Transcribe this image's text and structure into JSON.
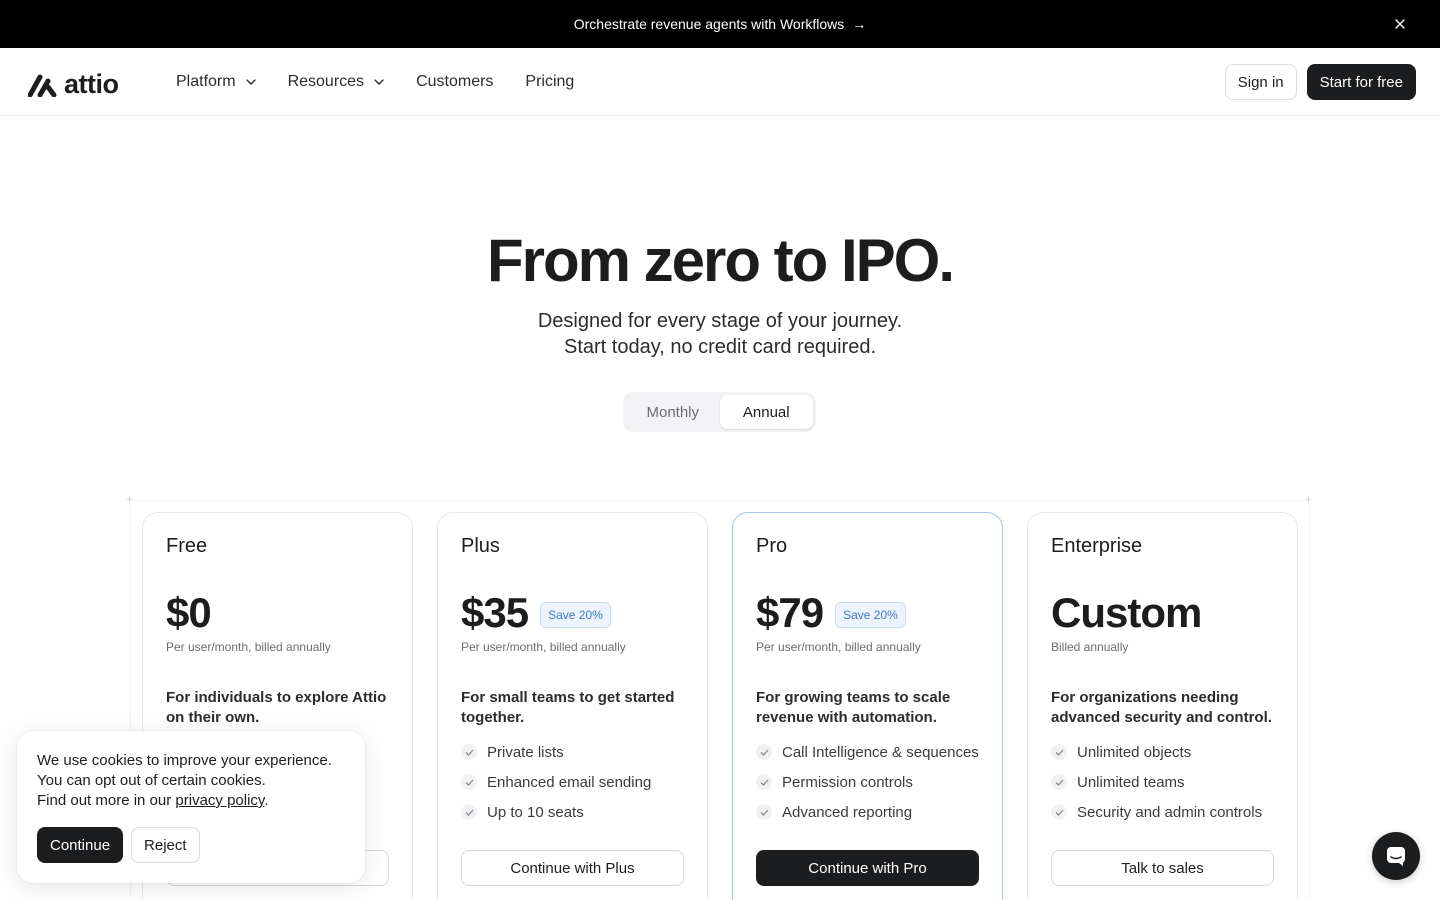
{
  "announcement": {
    "text": "Orchestrate revenue agents with Workflows",
    "arrow": "→"
  },
  "nav": {
    "logo_text": "attio",
    "items": [
      {
        "label": "Platform",
        "dropdown": true
      },
      {
        "label": "Resources",
        "dropdown": true
      },
      {
        "label": "Customers",
        "dropdown": false
      },
      {
        "label": "Pricing",
        "dropdown": false
      }
    ],
    "sign_in": "Sign in",
    "start": "Start for free"
  },
  "hero": {
    "title": "From zero to IPO.",
    "subtitle_line1": "Designed for every stage of your journey.",
    "subtitle_line2": "Start today, no credit card required."
  },
  "billing_toggle": {
    "options": [
      "Monthly",
      "Annual"
    ],
    "selected": "Annual"
  },
  "plans": [
    {
      "name": "Free",
      "price": "$0",
      "save": "",
      "billing": "Per user/month, billed annually",
      "description": "For individuals to explore Attio on their own.",
      "features": [
        "",
        "",
        ""
      ],
      "button": "",
      "highlight": false
    },
    {
      "name": "Plus",
      "price": "$35",
      "save": "Save 20%",
      "billing": "Per user/month, billed annually",
      "description": "For small teams to get started together.",
      "features": [
        "Private lists",
        "Enhanced email sending",
        "Up to 10 seats"
      ],
      "button": "Continue with Plus",
      "highlight": false
    },
    {
      "name": "Pro",
      "price": "$79",
      "save": "Save 20%",
      "billing": "Per user/month, billed annually",
      "description": "For growing teams to scale revenue with automation.",
      "features": [
        "Call Intelligence & sequences",
        "Permission controls",
        "Advanced reporting"
      ],
      "button": "Continue with Pro",
      "highlight": true
    },
    {
      "name": "Enterprise",
      "price": "Custom",
      "save": "",
      "billing": "Billed annually",
      "description": "For organizations needing advanced security and control.",
      "features": [
        "Unlimited objects",
        "Unlimited teams",
        "Security and admin controls"
      ],
      "button": "Talk to sales",
      "highlight": false
    }
  ],
  "cookie": {
    "line1": "We use cookies to improve your experience.",
    "line2": "You can opt out of certain cookies.",
    "line3_prefix": "Find out more in our ",
    "link": "privacy policy",
    "line3_suffix": ".",
    "continue": "Continue",
    "reject": "Reject"
  },
  "colors": {
    "accent_blue": "#3f78c9",
    "dark": "#1c1d1f",
    "pro_border": "#a9c4ee"
  }
}
